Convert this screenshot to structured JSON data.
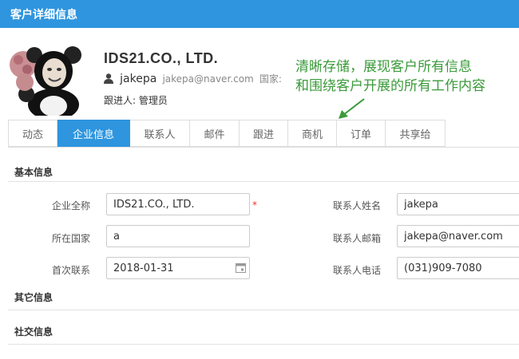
{
  "header": {
    "title": "客户详细信息"
  },
  "profile": {
    "company_name": "IDS21.CO., LTD.",
    "username": "jakepa",
    "email": "jakepa@naver.com",
    "country_label": "国家:",
    "follower_text": "跟进人: 管理员"
  },
  "callout": {
    "line1": "清晰存储，展现客户所有信息",
    "line2": "和围绕客户开展的所有工作内容",
    "color": "#3a9a3a"
  },
  "tabs": [
    {
      "label": "动态",
      "active": false
    },
    {
      "label": "企业信息",
      "active": true
    },
    {
      "label": "联系人",
      "active": false
    },
    {
      "label": "邮件",
      "active": false
    },
    {
      "label": "跟进",
      "active": false
    },
    {
      "label": "商机",
      "active": false
    },
    {
      "label": "订单",
      "active": false
    },
    {
      "label": "共享给",
      "active": false
    }
  ],
  "sections": {
    "basic": "基本信息",
    "other": "其它信息",
    "social": "社交信息"
  },
  "fields": {
    "company_full_name": {
      "label": "企业全称",
      "value": "IDS21.CO., LTD.",
      "required_mark": "*"
    },
    "country": {
      "label": "所在国家",
      "value": "a"
    },
    "first_contact": {
      "label": "首次联系",
      "value": "2018-01-31"
    },
    "contact_name": {
      "label": "联系人姓名",
      "value": "jakepa"
    },
    "contact_email": {
      "label": "联系人邮箱",
      "value": "jakepa@naver.com"
    },
    "contact_phone": {
      "label": "联系人电话",
      "value": "(031)909-7080"
    }
  },
  "colors": {
    "accent": "#2e95de",
    "required": "#e33333"
  }
}
